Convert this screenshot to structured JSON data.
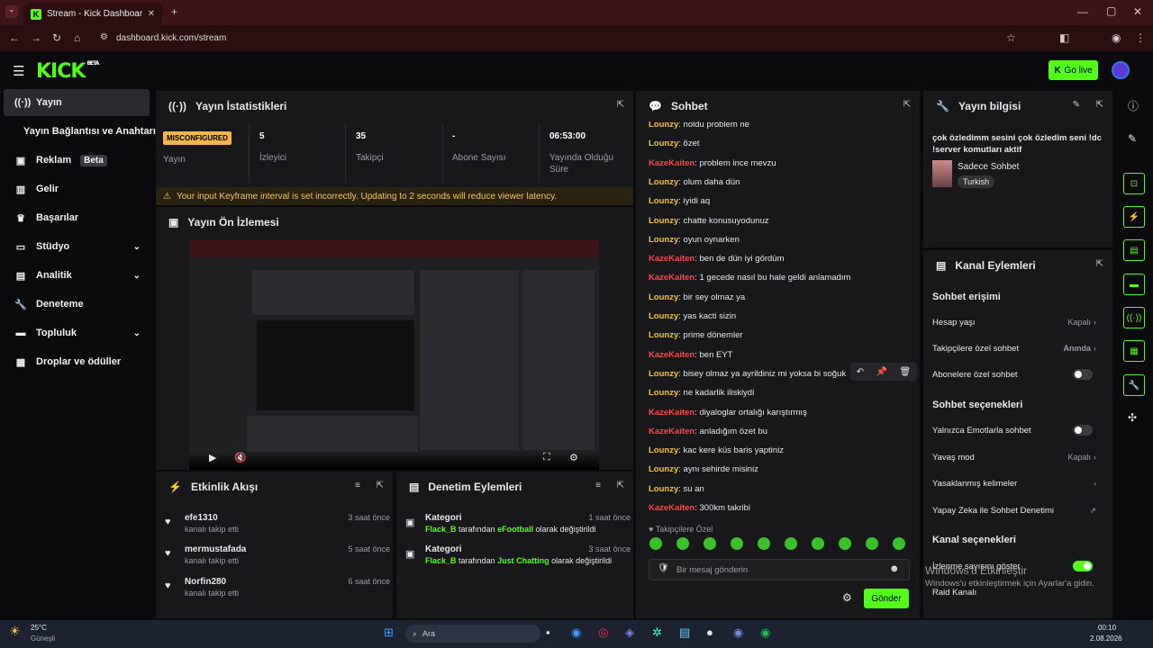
{
  "browser": {
    "tab_title": "Stream - Kick Dashboard",
    "url": "dashboard.kick.com/stream"
  },
  "header": {
    "logo": "KICK",
    "logo_badge": "BETA",
    "go_live": "Go live"
  },
  "sidebar": {
    "items": [
      {
        "label": "Yayın",
        "icon": "broadcast-icon"
      },
      {
        "label": "Yayın Bağlantısı ve Anahtarı"
      },
      {
        "label": "Reklam",
        "badge": "Beta",
        "icon": "ad-icon"
      },
      {
        "label": "Gelir",
        "icon": "chart-icon"
      },
      {
        "label": "Başarılar",
        "icon": "trophy-icon"
      },
      {
        "label": "Stüdyo",
        "icon": "studio-icon"
      },
      {
        "label": "Analitik",
        "icon": "analytics-icon"
      },
      {
        "label": "Deneteme",
        "icon": "wrench-icon"
      },
      {
        "label": "Topluluk",
        "icon": "community-icon"
      },
      {
        "label": "Droplar ve ödüller",
        "icon": "gift-icon"
      }
    ]
  },
  "stats": {
    "title": "Yayın İstatistikleri",
    "status_badge": "MISCONFIGURED",
    "status_label": "Yayın",
    "items": [
      {
        "value": "5",
        "label": "İzleyici"
      },
      {
        "value": "35",
        "label": "Takipçi"
      },
      {
        "value": "-",
        "label": "Abone Sayısı"
      },
      {
        "value": "06:53:00",
        "label": "Yayında Olduğu Süre"
      }
    ],
    "warning": "Your input Keyframe interval is set incorrectly. Updating to 2 seconds will reduce viewer latency."
  },
  "preview": {
    "title": "Yayın Ön İzlemesi"
  },
  "activity": {
    "title": "Etkinlik Akışı",
    "items": [
      {
        "name": "efe1310",
        "sub": "kanalı takip etti",
        "time": "3 saat önce"
      },
      {
        "name": "mermustafada",
        "sub": "kanalı takip etti",
        "time": "5 saat önce"
      },
      {
        "name": "Norfin280",
        "sub": "kanalı takip etti",
        "time": "6 saat önce"
      }
    ]
  },
  "moderation": {
    "title": "Denetim Eylemleri",
    "items": [
      {
        "title": "Kategori",
        "user": "Flack_B",
        "mid": "tarafından",
        "target": "eFootball",
        "end": "olarak değiştirildi",
        "time": "1 saat önce"
      },
      {
        "title": "Kategori",
        "user": "Flack_B",
        "mid": "tarafından",
        "target": "Just Chatting",
        "end": "olarak değiştirildi",
        "time": "3 saat önce"
      }
    ]
  },
  "chat": {
    "title": "Sohbet",
    "messages": [
      {
        "u": "Lounzy",
        "t": "noldu problem ne",
        "c": 1
      },
      {
        "u": "Lounzy",
        "t": "özet",
        "c": 1
      },
      {
        "u": "KazeKaiten",
        "t": "problem ince mevzu",
        "c": 2
      },
      {
        "u": "Lounzy",
        "t": "olum daha dün",
        "c": 1
      },
      {
        "u": "Lounzy",
        "t": "iyidi aq",
        "c": 1
      },
      {
        "u": "Lounzy",
        "t": "chatte konusuyodunuz",
        "c": 1
      },
      {
        "u": "Lounzy",
        "t": "oyun oynarken",
        "c": 1
      },
      {
        "u": "KazeKaiten",
        "t": "ben de dün iyi gördüm",
        "c": 2
      },
      {
        "u": "KazeKaiten",
        "t": "1 gecede nasıl bu hale geldi anlamadım",
        "c": 2
      },
      {
        "u": "Lounzy",
        "t": "bir sey olmaz ya",
        "c": 1
      },
      {
        "u": "Lounzy",
        "t": "yas kacti sizin",
        "c": 1
      },
      {
        "u": "Lounzy",
        "t": "prime dönemler",
        "c": 1
      },
      {
        "u": "KazeKaiten",
        "t": "ben EYT",
        "c": 2
      },
      {
        "u": "Lounzy",
        "t": "bisey olmaz ya ayrildiniz mi yoksa bi soğuk",
        "c": 1
      },
      {
        "u": "Lounzy",
        "t": "ne kadarlik iliskiydi",
        "c": 1
      },
      {
        "u": "KazeKaiten",
        "t": "diyaloglar ortalığı karıştırmış",
        "c": 2
      },
      {
        "u": "KazeKaiten",
        "t": "anladığım özet bu",
        "c": 2
      },
      {
        "u": "Lounzy",
        "t": "kac kere küs baris yaptiniz",
        "c": 1
      },
      {
        "u": "Lounzy",
        "t": "aynı sehirde misiniz",
        "c": 1
      },
      {
        "u": "Lounzy",
        "t": "su an",
        "c": 1
      },
      {
        "u": "KazeKaiten",
        "t": "300km takribi",
        "c": 2
      }
    ],
    "followers_only": "Takipçilere Özel",
    "placeholder": "Bir mesaj gönderin",
    "send": "Gönder"
  },
  "stream_info": {
    "title": "Yayın bilgisi",
    "text": "çok özledimm sesini çok özledim seni !dc !server komutları aktif",
    "category": "Sadece Sohbet",
    "language": "Turkish"
  },
  "channel_actions": {
    "title": "Kanal Eylemleri",
    "access_title": "Sohbet erişimi",
    "rows1": [
      {
        "label": "Hesap yaşı",
        "value": "Kapalı"
      },
      {
        "label": "Takipçilere özel sohbet",
        "value": "Anında"
      },
      {
        "label": "Abonelere özel sohbet"
      }
    ],
    "options_title": "Sohbet seçenekleri",
    "rows2": [
      {
        "label": "Yalnızca Emotlarla sohbet"
      },
      {
        "label": "Yavaş mod",
        "value": "Kapalı"
      },
      {
        "label": "Yasaklanmış kelimeler"
      },
      {
        "label": "Yapay Zeka ile Sohbet Denetimi"
      }
    ],
    "channel_title": "Kanal seçenekleri",
    "rows3": [
      {
        "label": "İzlenme sayısını göster"
      },
      {
        "label": "Raid Kanalı"
      }
    ]
  },
  "watermark": {
    "line1": "Windows'u Etkinleştir",
    "line2": "Windows'u etkinleştirmek için Ayarlar'a gidin."
  },
  "taskbar": {
    "weather_temp": "25°C",
    "weather_text": "Güneşli",
    "search": "Ara",
    "time": "00:10",
    "date": "2.08.2026"
  }
}
